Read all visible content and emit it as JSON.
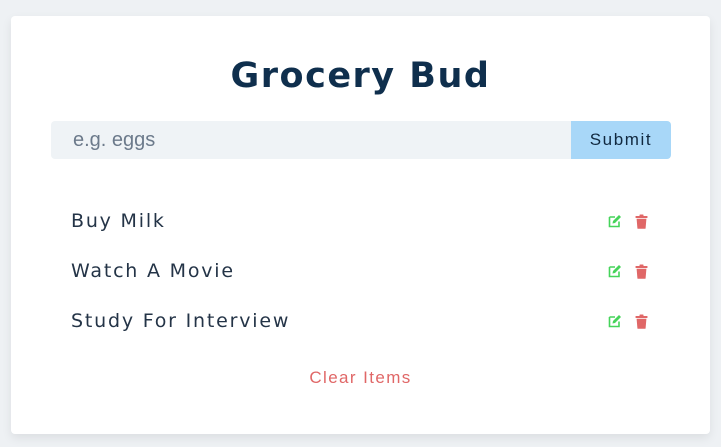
{
  "header": {
    "title": "Grocery Bud"
  },
  "form": {
    "input_value": "",
    "input_placeholder": "e.g. eggs",
    "submit_label": "Submit"
  },
  "items": [
    {
      "label": "Buy Milk",
      "edit_icon": "edit-icon",
      "delete_icon": "trash-icon"
    },
    {
      "label": "Watch A Movie",
      "edit_icon": "edit-icon",
      "delete_icon": "trash-icon"
    },
    {
      "label": "Study For Interview",
      "edit_icon": "edit-icon",
      "delete_icon": "trash-icon"
    }
  ],
  "footer": {
    "clear_label": "Clear Items"
  },
  "colors": {
    "background": "#eef1f4",
    "title": "#0f2f4d",
    "submit_bg": "#a8d7f8",
    "edit_icon": "#45d45a",
    "delete_icon": "#e06767",
    "clear_text": "#e06767"
  }
}
